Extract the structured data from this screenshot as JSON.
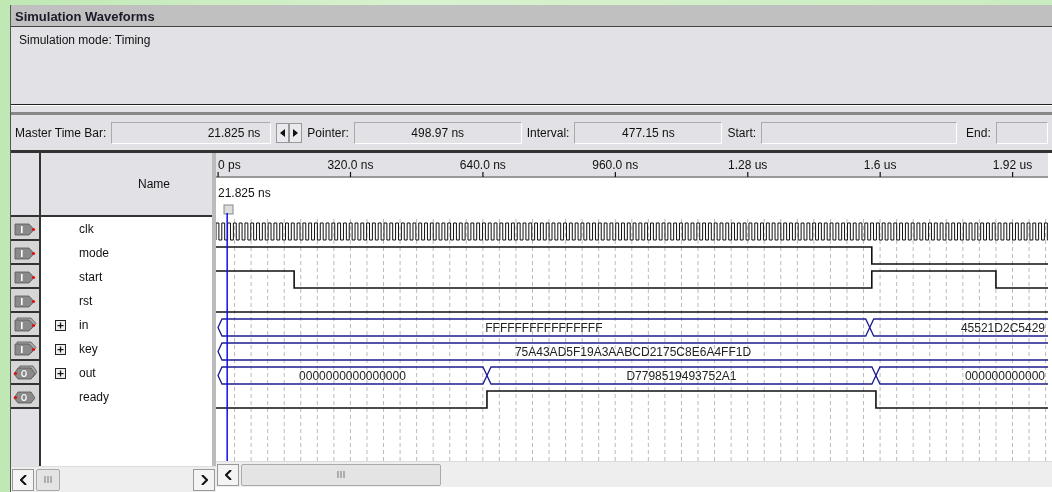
{
  "window": {
    "title": "Simulation Waveforms"
  },
  "info": {
    "text": "Simulation mode: Timing"
  },
  "toolbar": {
    "master_time_bar": {
      "label": "Master Time Bar:",
      "value": "21.825 ns"
    },
    "pointer": {
      "label": "Pointer:",
      "value": "498.97 ns"
    },
    "interval": {
      "label": "Interval:",
      "value": "477.15 ns"
    },
    "start": {
      "label": "Start:"
    },
    "end": {
      "label": "End:"
    }
  },
  "name_header": "Name",
  "timeline": {
    "ticks": [
      "0 ps",
      "320.0 ns",
      "640.0 ns",
      "960.0 ns",
      "1.28 us",
      "1.6 us",
      "1.92 us"
    ],
    "cursor": "21.825 ns"
  },
  "signals": [
    {
      "name": "clk",
      "output": false,
      "kind": "clock"
    },
    {
      "name": "mode",
      "output": false,
      "kind": "bit"
    },
    {
      "name": "start",
      "output": false,
      "kind": "bit"
    },
    {
      "name": "rst",
      "output": false,
      "kind": "bit"
    },
    {
      "name": "in",
      "output": false,
      "kind": "bus",
      "expanded": false,
      "segments": [
        {
          "value": "FFFFFFFFFFFFFFFF"
        },
        {
          "value": "45521D2C5429"
        }
      ]
    },
    {
      "name": "key",
      "output": false,
      "kind": "bus",
      "expanded": false,
      "segments": [
        {
          "value": "75A43AD5F19A3AABCD2175C8E6A4FF1D"
        }
      ]
    },
    {
      "name": "out",
      "output": true,
      "kind": "bus",
      "expanded": false,
      "segments": [
        {
          "value": "0000000000000000"
        },
        {
          "value": "D7798519493752A1"
        },
        {
          "value": "000000000000"
        }
      ]
    },
    {
      "name": "ready",
      "output": true,
      "kind": "bit"
    }
  ]
}
